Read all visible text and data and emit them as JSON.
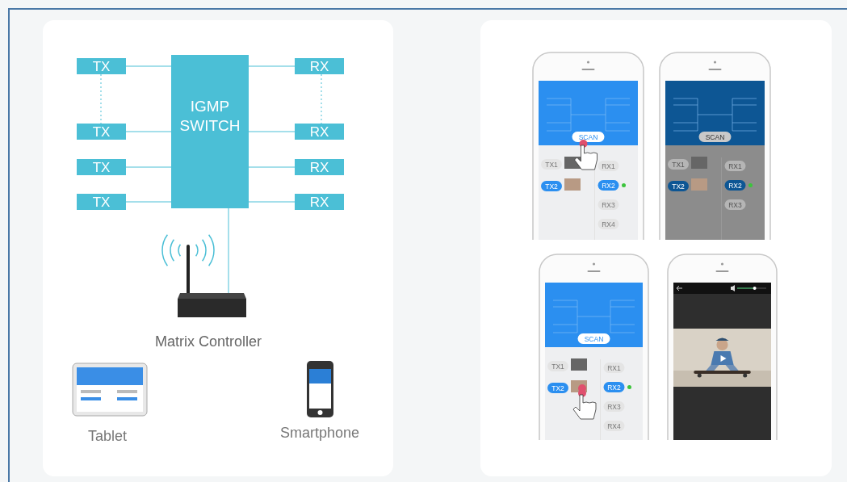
{
  "diagram": {
    "transmitters": [
      {
        "label": "TX"
      },
      {
        "label": "TX"
      },
      {
        "label": "TX"
      },
      {
        "label": "TX"
      }
    ],
    "switch": {
      "label_lines": [
        "IGMP",
        "SWITCH"
      ]
    },
    "receivers": [
      {
        "label": "RX"
      },
      {
        "label": "RX"
      },
      {
        "label": "RX"
      },
      {
        "label": "RX"
      }
    ],
    "controller": {
      "label": "Matrix Controller"
    },
    "clients": [
      {
        "kind": "tablet",
        "label": "Tablet"
      },
      {
        "kind": "smartphone",
        "label": "Smartphone"
      }
    ]
  },
  "phones": [
    {
      "kind": "app",
      "dimmed": false,
      "button": {
        "label": "SCAN",
        "touched": true
      },
      "tx": [
        {
          "label": "TX1",
          "selected": false,
          "touched": false
        },
        {
          "label": "TX2",
          "selected": true,
          "touched": false
        }
      ],
      "rx": [
        {
          "label": "RX1",
          "selected": false
        },
        {
          "label": "RX2",
          "selected": true
        },
        {
          "label": "RX3",
          "selected": false
        },
        {
          "label": "RX4",
          "selected": false
        }
      ]
    },
    {
      "kind": "app",
      "dimmed": true,
      "button": {
        "label": "SCAN",
        "touched": false
      },
      "tx": [
        {
          "label": "TX1",
          "selected": false,
          "touched": false
        },
        {
          "label": "TX2",
          "selected": true,
          "touched": false
        }
      ],
      "rx": [
        {
          "label": "RX1",
          "selected": false
        },
        {
          "label": "RX2",
          "selected": true
        },
        {
          "label": "RX3",
          "selected": false
        }
      ]
    },
    {
      "kind": "app",
      "dimmed": false,
      "button": {
        "label": "SCAN",
        "touched": false
      },
      "tx": [
        {
          "label": "TX1",
          "selected": false,
          "touched": false
        },
        {
          "label": "TX2",
          "selected": true,
          "touched": true
        }
      ],
      "rx": [
        {
          "label": "RX1",
          "selected": false
        },
        {
          "label": "RX2",
          "selected": true
        },
        {
          "label": "RX3",
          "selected": false
        },
        {
          "label": "RX4",
          "selected": false
        }
      ]
    },
    {
      "kind": "video",
      "volume": {
        "level": 0.6
      }
    }
  ]
}
